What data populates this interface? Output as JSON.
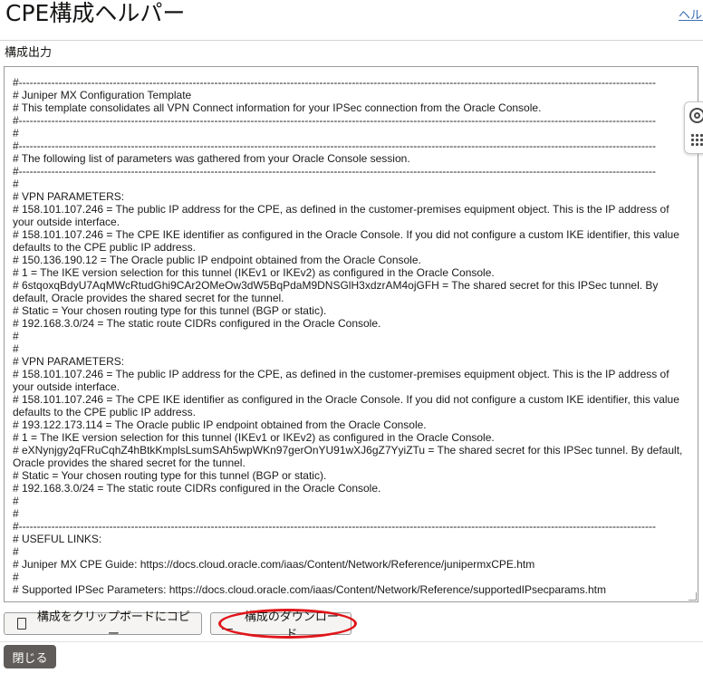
{
  "header": {
    "title": "CPE構成ヘルパー",
    "help_link": "ヘルプ"
  },
  "section": {
    "label": "構成出力"
  },
  "output": {
    "text": "#--------------------------------------------------------------------------------------------------------------------------------------------------------------------------------\n# Juniper MX Configuration Template\n# This template consolidates all VPN Connect information for your IPSec connection from the Oracle Console.\n#--------------------------------------------------------------------------------------------------------------------------------------------------------------------------------\n#\n#--------------------------------------------------------------------------------------------------------------------------------------------------------------------------------\n# The following list of parameters was gathered from your Oracle Console session.\n#--------------------------------------------------------------------------------------------------------------------------------------------------------------------------------\n#\n# VPN PARAMETERS:\n# 158.101.107.246 = The public IP address for the CPE, as defined in the customer-premises equipment object. This is the IP address of your outside interface.\n# 158.101.107.246 = The CPE IKE identifier as configured in the Oracle Console. If you did not configure a custom IKE identifier, this value defaults to the CPE public IP address.\n# 150.136.190.12 = The Oracle public IP endpoint obtained from the Oracle Console.\n# 1 = The IKE version selection for this tunnel (IKEv1 or IKEv2) as configured in the Oracle Console.\n# 6stqoxqBdyU7AqMWcRtudGhi9CAr2OMeOw3dW5BqPdaM9DNSGlH3xdzrAM4ojGFH = The shared secret for this IPSec tunnel. By default, Oracle provides the shared secret for the tunnel.\n# Static = Your chosen routing type for this tunnel (BGP or static).\n# 192.168.3.0/24 = The static route CIDRs configured in the Oracle Console.\n#\n#\n# VPN PARAMETERS:\n# 158.101.107.246 = The public IP address for the CPE, as defined in the customer-premises equipment object. This is the IP address of your outside interface.\n# 158.101.107.246 = The CPE IKE identifier as configured in the Oracle Console. If you did not configure a custom IKE identifier, this value defaults to the CPE public IP address.\n# 193.122.173.114 = The Oracle public IP endpoint obtained from the Oracle Console.\n# 1 = The IKE version selection for this tunnel (IKEv1 or IKEv2) as configured in the Oracle Console.\n# eXNynjgy2qFRuCqhZ4hBtkKmplsLsumSAh5wpWKn97gerOnYU91wXJ6gZ7YyiZTu = The shared secret for this IPSec tunnel. By default, Oracle provides the shared secret for the tunnel.\n# Static = Your chosen routing type for this tunnel (BGP or static).\n# 192.168.3.0/24 = The static route CIDRs configured in the Oracle Console.\n#\n#\n#--------------------------------------------------------------------------------------------------------------------------------------------------------------------------------\n# USEFUL LINKS:\n#\n# Juniper MX CPE Guide: https://docs.cloud.oracle.com/iaas/Content/Network/Reference/junipermxCPE.htm\n#\n# Supported IPSec Parameters: https://docs.cloud.oracle.com/iaas/Content/Network/Reference/supportedIPsecparams.htm"
  },
  "actions": {
    "copy_label": "構成をクリップボードにコピー",
    "download_label": "構成のダウンロード",
    "close_label": "閉じる"
  },
  "icons": {
    "copy": "clipboard-icon",
    "download": "download-icon",
    "help": "help-lifebuoy-icon",
    "apps": "app-grid-icon"
  },
  "colors": {
    "highlight": "#e0151a",
    "link": "#3a6fb3",
    "close_button": "#5f5c59"
  }
}
